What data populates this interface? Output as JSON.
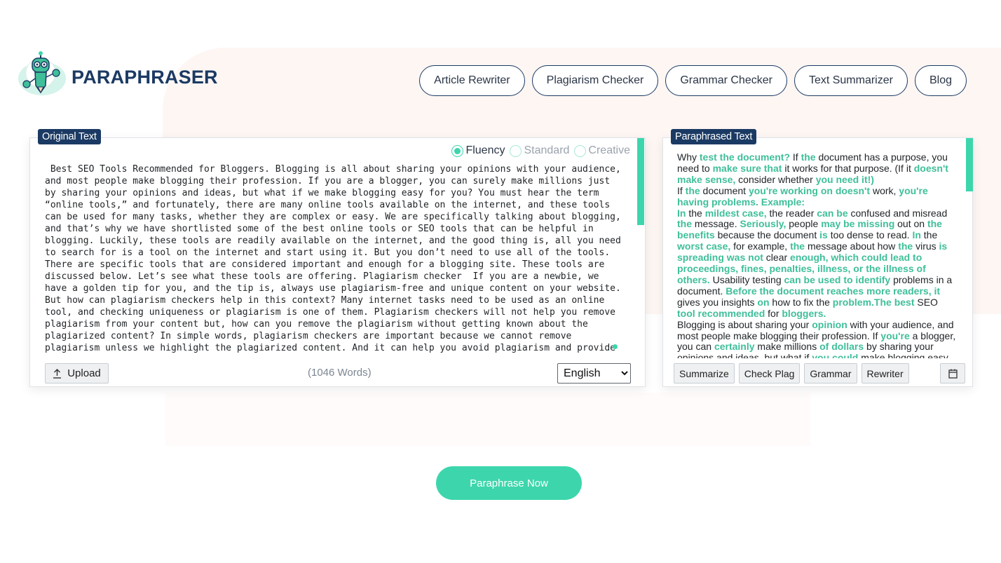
{
  "brand": {
    "name": "PARAPHRASER",
    "accent": "#3dd6ac",
    "navy": "#1b3a63"
  },
  "nav": [
    {
      "label": "Article Rewriter"
    },
    {
      "label": "Plagiarism Checker"
    },
    {
      "label": "Grammar Checker"
    },
    {
      "label": "Text Summarizer"
    },
    {
      "label": "Blog"
    }
  ],
  "original": {
    "tag": "Original Text",
    "modes": [
      {
        "label": "Fluency",
        "selected": true
      },
      {
        "label": "Standard",
        "selected": false
      },
      {
        "label": "Creative",
        "selected": false
      }
    ],
    "text": " Best SEO Tools Recommended for Bloggers. Blogging is all about sharing your opinions with your audience, and most people make blogging their profession. If you are a blogger, you can surely make millions just by sharing your opinions and ideas, but what if we make blogging easy for you? You must hear the term “online tools,” and fortunately, there are many online tools available on the internet, and these tools can be used for many tasks, whether they are complex or easy. We are specifically talking about blogging, and that’s why we have shortlisted some of the best online tools or SEO tools that can be helpful in blogging. Luckily, these tools are readily available on the internet, and the good thing is, all you need to search for is a tool on the internet and start using it. But you don’t need to use all of the tools. There are specific tools that are considered important and enough for a blogging site. These tools are discussed below. Let’s see what these tools are offering. Plagiarism checker  If you are a newbie, we have a golden tip for you, and the tip is, always use plagiarism-free and unique content on your website. But how can plagiarism checkers help in this context? Many internet tasks need to be used as an online tool, and checking uniqueness or plagiarism is one of them. Plagiarism checkers will not help you remove plagiarism from your content but, how can you remove the plagiarism without getting known about the plagiarized content? In simple words, plagiarism checkers are important because we cannot remove plagiarism unless we highlight the plagiarized content. And it can help you avoid plagiarism and provide unique content on your website.",
    "upload_label": "Upload",
    "word_count": "(1046 Words)",
    "language": "English"
  },
  "paraphrased": {
    "tag": "Paraphrased Text",
    "segments": [
      {
        "t": "Why ",
        "h": false
      },
      {
        "t": "test the document?",
        "h": true
      },
      {
        "t": " If ",
        "h": false
      },
      {
        "t": "the",
        "h": true
      },
      {
        "t": " document has a purpose, you need to ",
        "h": false
      },
      {
        "t": "make sure that",
        "h": true
      },
      {
        "t": " it works for that purpose. (If it ",
        "h": false
      },
      {
        "t": "doesn't make sense,",
        "h": true
      },
      {
        "t": " consider whether ",
        "h": false
      },
      {
        "t": "you need it!)",
        "h": true
      },
      {
        "t": "\n If ",
        "h": false
      },
      {
        "t": "the",
        "h": true
      },
      {
        "t": " document ",
        "h": false
      },
      {
        "t": "you're working on doesn't",
        "h": true
      },
      {
        "t": " work, ",
        "h": false
      },
      {
        "t": "you're having problems. Example:",
        "h": true
      },
      {
        "t": "\n ",
        "h": false
      },
      {
        "t": "In",
        "h": true
      },
      {
        "t": " the ",
        "h": false
      },
      {
        "t": "mildest case,",
        "h": true
      },
      {
        "t": " the reader ",
        "h": false
      },
      {
        "t": "can be",
        "h": true
      },
      {
        "t": " confused and misread ",
        "h": false
      },
      {
        "t": "the",
        "h": true
      },
      {
        "t": " message. ",
        "h": false
      },
      {
        "t": "Seriously,",
        "h": true
      },
      {
        "t": " people ",
        "h": false
      },
      {
        "t": "may be missing",
        "h": true
      },
      {
        "t": " out on ",
        "h": false
      },
      {
        "t": "the benefits",
        "h": true
      },
      {
        "t": " because the document ",
        "h": false
      },
      {
        "t": "is",
        "h": true
      },
      {
        "t": " too dense to read. ",
        "h": false
      },
      {
        "t": "In",
        "h": true
      },
      {
        "t": " the ",
        "h": false
      },
      {
        "t": "worst case,",
        "h": true
      },
      {
        "t": " for example, ",
        "h": false
      },
      {
        "t": "the",
        "h": true
      },
      {
        "t": " message about how ",
        "h": false
      },
      {
        "t": "the",
        "h": true
      },
      {
        "t": " virus ",
        "h": false
      },
      {
        "t": "is spreading was not",
        "h": true
      },
      {
        "t": " clear ",
        "h": false
      },
      {
        "t": "enough, which could lead to proceedings, fines, penalties, illness, or the illness of others.",
        "h": true
      },
      {
        "t": " Usability testing ",
        "h": false
      },
      {
        "t": "can be used to identify",
        "h": true
      },
      {
        "t": " problems in a document. ",
        "h": false
      },
      {
        "t": "Before the document reaches more readers, it",
        "h": true
      },
      {
        "t": " gives you insights ",
        "h": false
      },
      {
        "t": "on",
        "h": true
      },
      {
        "t": " how to fix the ",
        "h": false
      },
      {
        "t": "problem.The best",
        "h": true
      },
      {
        "t": " SEO ",
        "h": false
      },
      {
        "t": "tool recommended",
        "h": true
      },
      {
        "t": " for ",
        "h": false
      },
      {
        "t": "bloggers.",
        "h": true
      },
      {
        "t": "\nBlogging is  about sharing your ",
        "h": false
      },
      {
        "t": "opinion",
        "h": true
      },
      {
        "t": " with your audience, and most people make blogging their profession. If ",
        "h": false
      },
      {
        "t": "you're",
        "h": true
      },
      {
        "t": " a blogger, you can ",
        "h": false
      },
      {
        "t": "certainly",
        "h": true
      },
      {
        "t": " make millions ",
        "h": false
      },
      {
        "t": "of dollars",
        "h": true
      },
      {
        "t": " by sharing your opinions and ideas, but what if ",
        "h": false
      },
      {
        "t": "you could",
        "h": true
      },
      {
        "t": " make blogging easy for you?",
        "h": false
      }
    ],
    "tools": [
      {
        "label": "Summarize"
      },
      {
        "label": "Check Plag"
      },
      {
        "label": "Grammar"
      },
      {
        "label": "Rewriter"
      }
    ]
  },
  "cta": {
    "label": "Paraphrase Now"
  }
}
